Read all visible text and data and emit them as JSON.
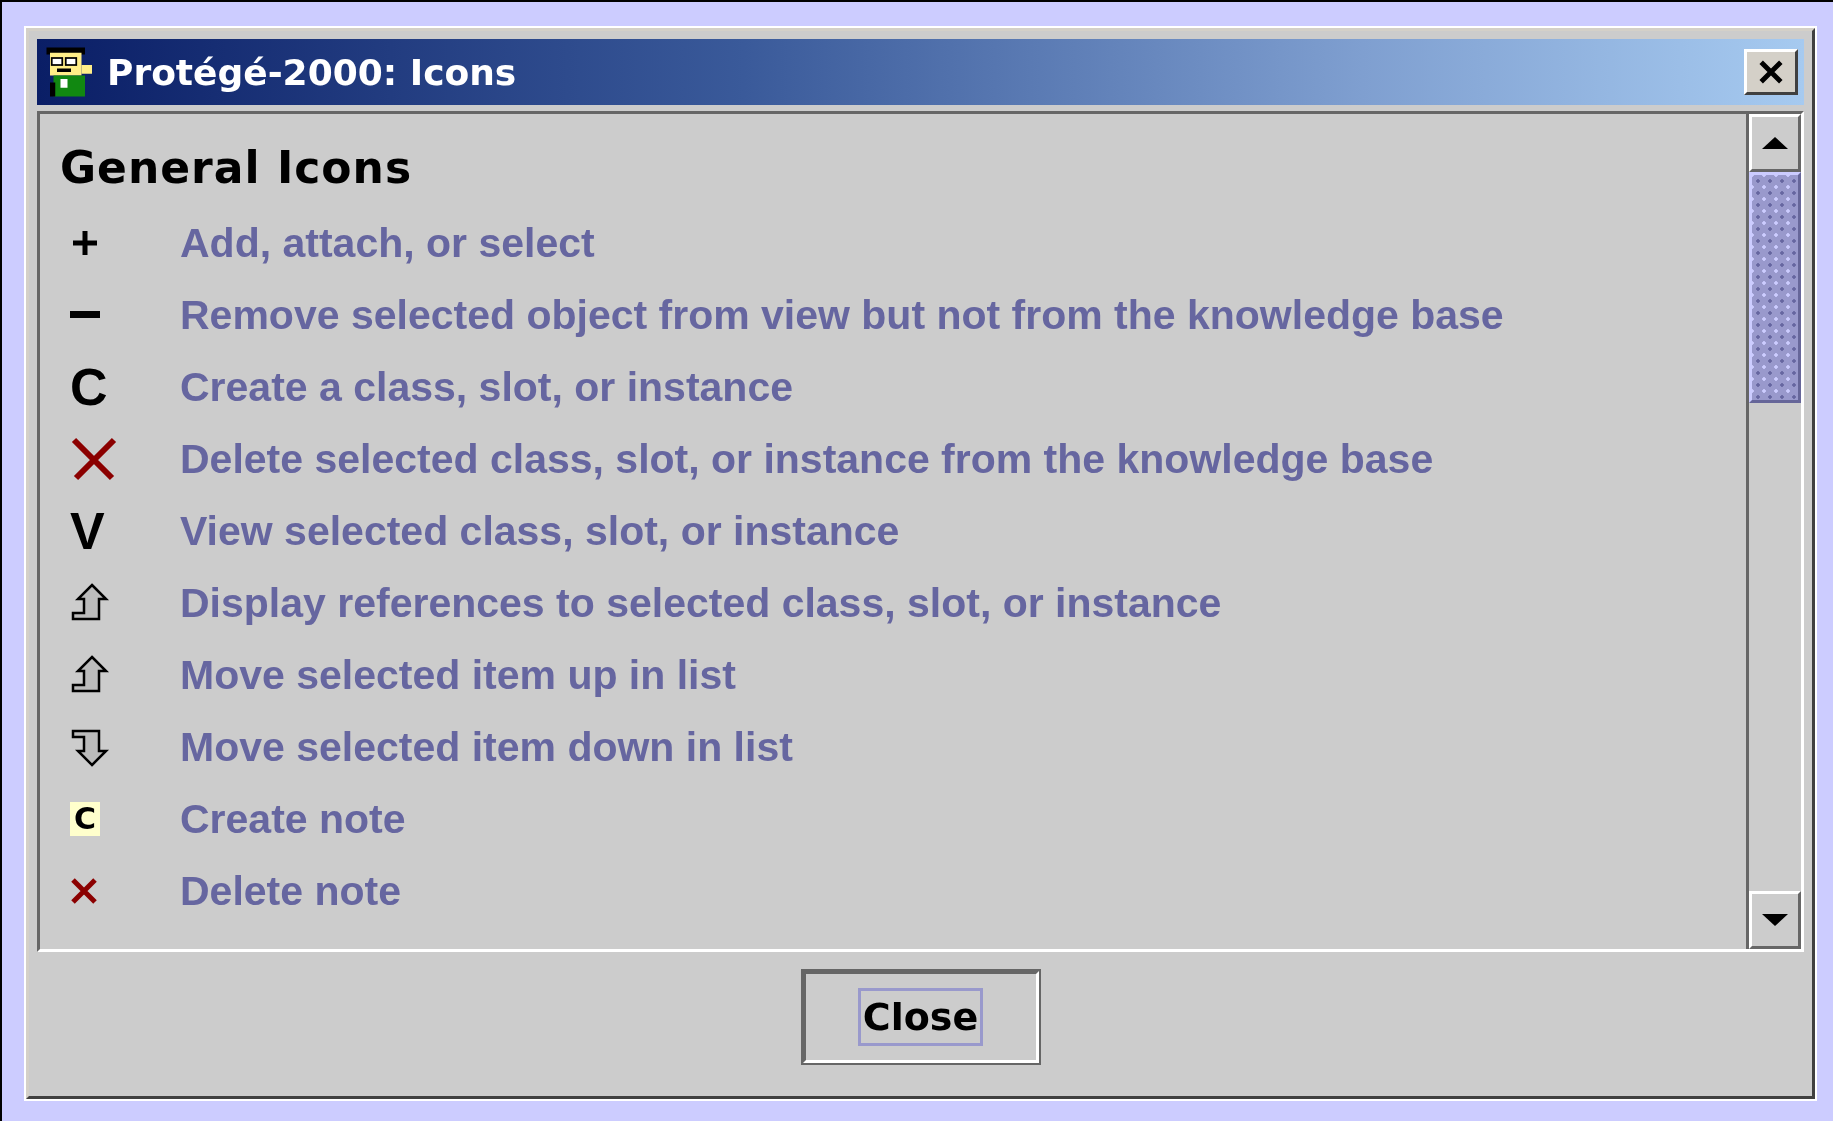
{
  "window": {
    "title": "Protégé-2000: Icons"
  },
  "section": {
    "heading": "General Icons"
  },
  "rows": [
    {
      "kind": "plus",
      "label": "Add, attach, or select"
    },
    {
      "kind": "minus",
      "label": "Remove selected object from view but not from the knowledge base"
    },
    {
      "kind": "glyph",
      "glyph": "C",
      "label": "Create a class, slot, or instance"
    },
    {
      "kind": "cross",
      "label": "Delete selected class, slot, or instance from the knowledge base"
    },
    {
      "kind": "glyph",
      "glyph": "V",
      "label": "View selected class, slot, or instance"
    },
    {
      "kind": "up",
      "label": "Display references to selected class, slot, or instance"
    },
    {
      "kind": "up",
      "label": "Move selected item up in list"
    },
    {
      "kind": "down",
      "label": "Move selected item down in list"
    },
    {
      "kind": "note",
      "glyph": "C",
      "label": "Create note"
    },
    {
      "kind": "small-cross",
      "label": "Delete note"
    }
  ],
  "buttons": [
    "Close"
  ]
}
